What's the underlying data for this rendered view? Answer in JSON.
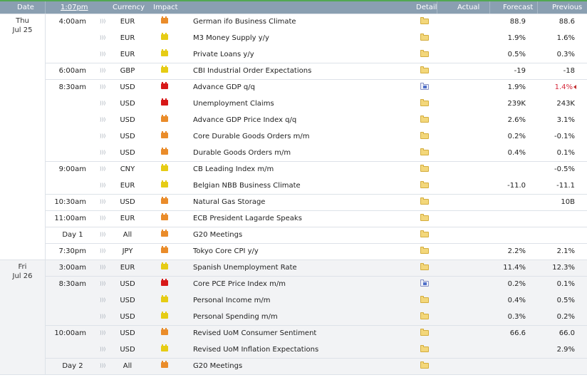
{
  "header": {
    "date": "Date",
    "time": "1:07pm",
    "currency": "Currency",
    "impact": "Impact",
    "detail": "Detail",
    "actual": "Actual",
    "forecast": "Forecast",
    "previous": "Previous"
  },
  "colors": {
    "header_bg": "#8a9fb1",
    "top_accent": "#52a852",
    "alt_day_bg": "#f2f3f5",
    "worse_value": "#d6293b",
    "impact_low": "#e6cc14",
    "impact_medium": "#ea8c2a",
    "impact_high": "#d71818"
  },
  "icons": {
    "sound": "speaker-icon",
    "detail": "folder-icon",
    "revised": "revision-arrow-icon"
  },
  "days": [
    {
      "weekday": "Thu",
      "date": "Jul 25",
      "first_row": 0,
      "row_count": 15
    },
    {
      "weekday": "Fri",
      "date": "Jul 26",
      "first_row": 15,
      "row_count": 7
    }
  ],
  "rows": [
    {
      "time": "4:00am",
      "currency": "EUR",
      "impact": "medium",
      "event": "German ifo Business Climate",
      "detail": "folder",
      "actual": "",
      "forecast": "88.9",
      "previous": "88.6",
      "group_start": true
    },
    {
      "time": "",
      "currency": "EUR",
      "impact": "low",
      "event": "M3 Money Supply y/y",
      "detail": "folder",
      "actual": "",
      "forecast": "1.9%",
      "previous": "1.6%"
    },
    {
      "time": "",
      "currency": "EUR",
      "impact": "low",
      "event": "Private Loans y/y",
      "detail": "folder",
      "actual": "",
      "forecast": "0.5%",
      "previous": "0.3%"
    },
    {
      "time": "6:00am",
      "currency": "GBP",
      "impact": "low",
      "event": "CBI Industrial Order Expectations",
      "detail": "folder",
      "actual": "",
      "forecast": "-19",
      "previous": "-18",
      "group_start": true
    },
    {
      "time": "8:30am",
      "currency": "USD",
      "impact": "high",
      "event": "Advance GDP q/q",
      "detail": "folder-data",
      "actual": "",
      "forecast": "1.9%",
      "previous": "1.4%",
      "previous_worse": true,
      "group_start": true
    },
    {
      "time": "",
      "currency": "USD",
      "impact": "high",
      "event": "Unemployment Claims",
      "detail": "folder",
      "actual": "",
      "forecast": "239K",
      "previous": "243K"
    },
    {
      "time": "",
      "currency": "USD",
      "impact": "medium",
      "event": "Advance GDP Price Index q/q",
      "detail": "folder",
      "actual": "",
      "forecast": "2.6%",
      "previous": "3.1%"
    },
    {
      "time": "",
      "currency": "USD",
      "impact": "medium",
      "event": "Core Durable Goods Orders m/m",
      "detail": "folder",
      "actual": "",
      "forecast": "0.2%",
      "previous": "-0.1%"
    },
    {
      "time": "",
      "currency": "USD",
      "impact": "medium",
      "event": "Durable Goods Orders m/m",
      "detail": "folder",
      "actual": "",
      "forecast": "0.4%",
      "previous": "0.1%"
    },
    {
      "time": "9:00am",
      "currency": "CNY",
      "impact": "low",
      "event": "CB Leading Index m/m",
      "detail": "folder",
      "actual": "",
      "forecast": "",
      "previous": "-0.5%",
      "group_start": true
    },
    {
      "time": "",
      "currency": "EUR",
      "impact": "low",
      "event": "Belgian NBB Business Climate",
      "detail": "folder",
      "actual": "",
      "forecast": "-11.0",
      "previous": "-11.1"
    },
    {
      "time": "10:30am",
      "currency": "USD",
      "impact": "medium",
      "event": "Natural Gas Storage",
      "detail": "folder",
      "actual": "",
      "forecast": "",
      "previous": "10B",
      "group_start": true
    },
    {
      "time": "11:00am",
      "currency": "EUR",
      "impact": "medium",
      "event": "ECB President Lagarde Speaks",
      "detail": "folder",
      "actual": "",
      "forecast": "",
      "previous": "",
      "group_start": true
    },
    {
      "time": "Day 1",
      "currency": "All",
      "impact": "medium",
      "event": "G20 Meetings",
      "detail": "folder",
      "actual": "",
      "forecast": "",
      "previous": "",
      "group_start": true,
      "time_center": true
    },
    {
      "time": "7:30pm",
      "currency": "JPY",
      "impact": "medium",
      "event": "Tokyo Core CPI y/y",
      "detail": "folder",
      "actual": "",
      "forecast": "2.2%",
      "previous": "2.1%",
      "group_start": true
    },
    {
      "time": "3:00am",
      "currency": "EUR",
      "impact": "low",
      "event": "Spanish Unemployment Rate",
      "detail": "folder",
      "actual": "",
      "forecast": "11.4%",
      "previous": "12.3%",
      "group_start": true
    },
    {
      "time": "8:30am",
      "currency": "USD",
      "impact": "high",
      "event": "Core PCE Price Index m/m",
      "detail": "folder-data",
      "actual": "",
      "forecast": "0.2%",
      "previous": "0.1%",
      "group_start": true
    },
    {
      "time": "",
      "currency": "USD",
      "impact": "low",
      "event": "Personal Income m/m",
      "detail": "folder",
      "actual": "",
      "forecast": "0.4%",
      "previous": "0.5%"
    },
    {
      "time": "",
      "currency": "USD",
      "impact": "low",
      "event": "Personal Spending m/m",
      "detail": "folder",
      "actual": "",
      "forecast": "0.3%",
      "previous": "0.2%"
    },
    {
      "time": "10:00am",
      "currency": "USD",
      "impact": "medium",
      "event": "Revised UoM Consumer Sentiment",
      "detail": "folder",
      "actual": "",
      "forecast": "66.6",
      "previous": "66.0",
      "group_start": true
    },
    {
      "time": "",
      "currency": "USD",
      "impact": "low",
      "event": "Revised UoM Inflation Expectations",
      "detail": "folder",
      "actual": "",
      "forecast": "",
      "previous": "2.9%"
    },
    {
      "time": "Day 2",
      "currency": "All",
      "impact": "medium",
      "event": "G20 Meetings",
      "detail": "folder",
      "actual": "",
      "forecast": "",
      "previous": "",
      "group_start": true,
      "time_center": true
    }
  ]
}
